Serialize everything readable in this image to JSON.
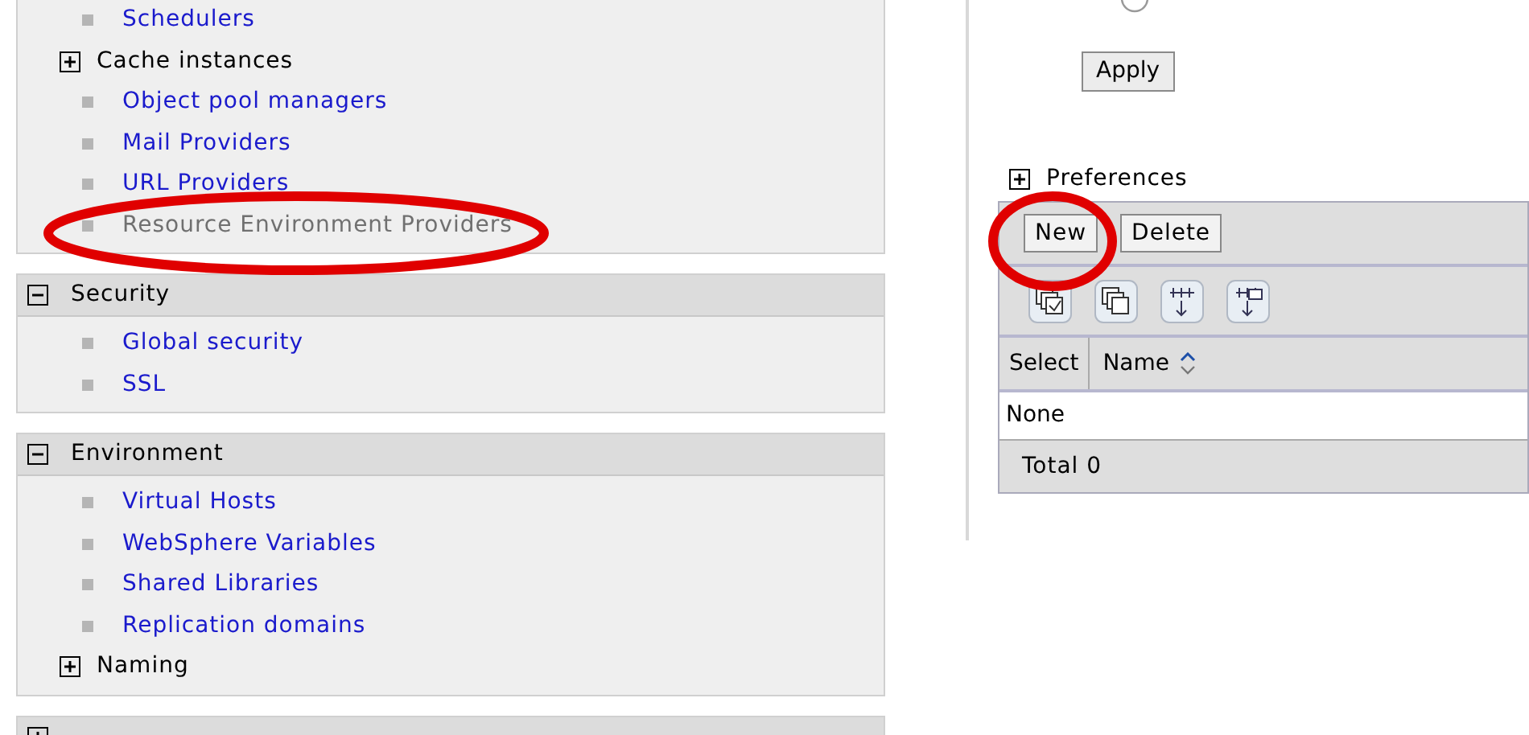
{
  "sections": [
    {
      "items": [
        {
          "label": "Schedulers",
          "kind": "link"
        },
        {
          "label": "Cache instances",
          "kind": "group"
        },
        {
          "label": "Object pool managers",
          "kind": "link"
        },
        {
          "label": "Mail Providers",
          "kind": "link"
        },
        {
          "label": "URL Providers",
          "kind": "link"
        },
        {
          "label": "Resource Environment Providers",
          "kind": "current"
        }
      ]
    },
    {
      "title": "Security",
      "expanded": true,
      "items": [
        {
          "label": "Global security",
          "kind": "link"
        },
        {
          "label": "SSL",
          "kind": "link"
        }
      ]
    },
    {
      "title": "Environment",
      "expanded": true,
      "items": [
        {
          "label": "Virtual Hosts",
          "kind": "link"
        },
        {
          "label": "WebSphere Variables",
          "kind": "link"
        },
        {
          "label": "Shared Libraries",
          "kind": "link"
        },
        {
          "label": "Replication domains",
          "kind": "link"
        },
        {
          "label": "Naming",
          "kind": "group"
        }
      ]
    },
    {
      "expanded": false
    }
  ],
  "apply_button": "Apply",
  "preferences": {
    "label": "Preferences",
    "expanded": false
  },
  "buttons": [
    "New",
    "Delete"
  ],
  "table": {
    "columns": [
      "Select",
      "Name"
    ],
    "empty_text": "None",
    "total": "Total 0"
  }
}
